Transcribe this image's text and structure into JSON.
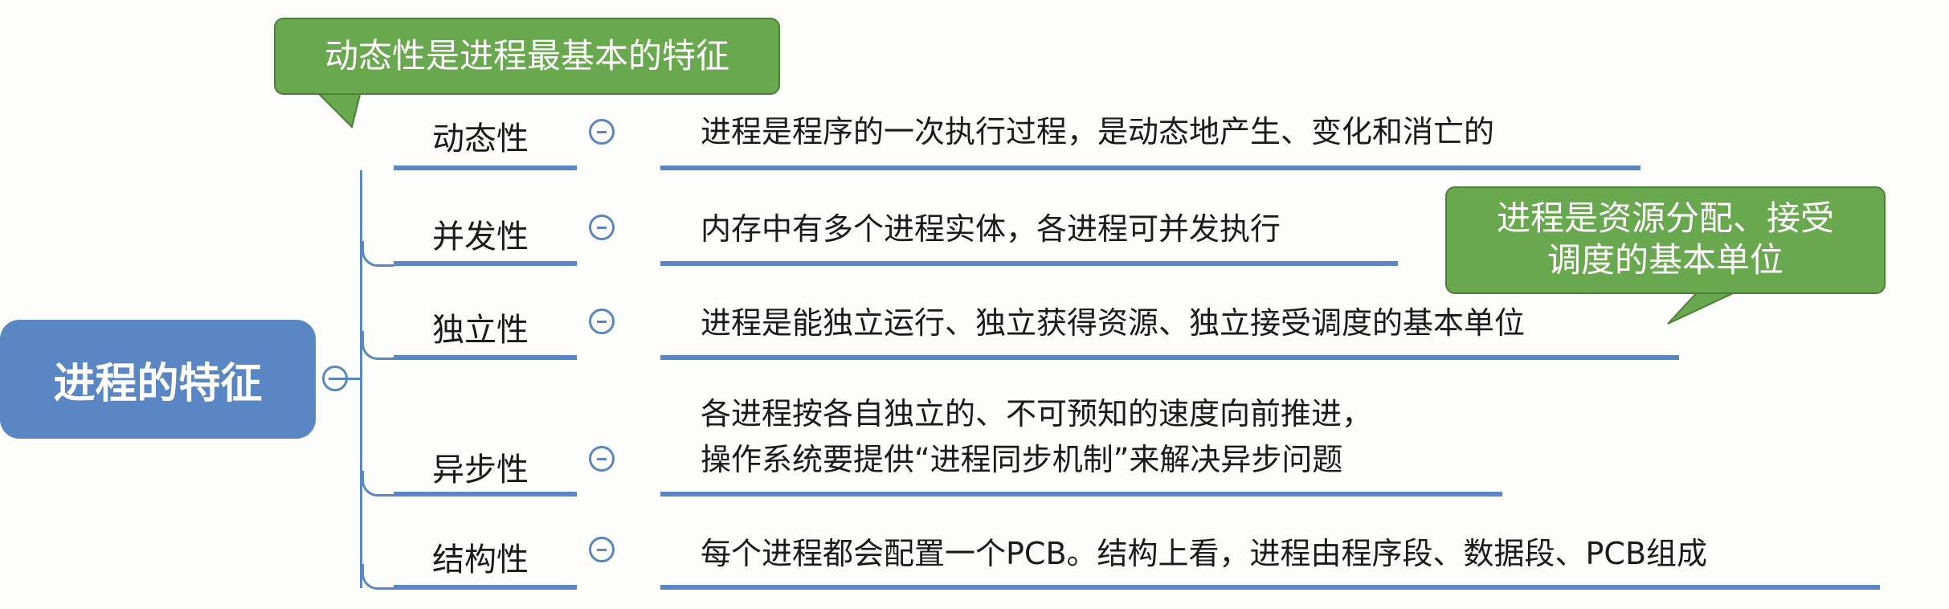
{
  "root": {
    "label": "进程的特征"
  },
  "features": [
    {
      "name": "动态性",
      "description": [
        "进程是程序的一次执行过程，是动态地产生、变化和消亡的"
      ]
    },
    {
      "name": "并发性",
      "description": [
        "内存中有多个进程实体，各进程可并发执行"
      ]
    },
    {
      "name": "独立性",
      "description": [
        "进程是能独立运行、独立获得资源、独立接受调度的基本单位"
      ]
    },
    {
      "name": "异步性",
      "description": [
        "各进程按各自独立的、不可预知的速度向前推进，",
        "操作系统要提供“进程同步机制”来解决异步问题"
      ]
    },
    {
      "name": "结构性",
      "description": [
        "每个进程都会配置一个PCB。结构上看，进程由程序段、数据段、PCB组成"
      ]
    }
  ],
  "callouts": [
    {
      "lines": [
        "动态性是进程最基本的特征"
      ]
    },
    {
      "lines": [
        "进程是资源分配、接受",
        "调度的基本单位"
      ]
    }
  ],
  "colors": {
    "node": "#5b86c4",
    "callout": "#6aa84f",
    "text": "#1b1b1b"
  }
}
